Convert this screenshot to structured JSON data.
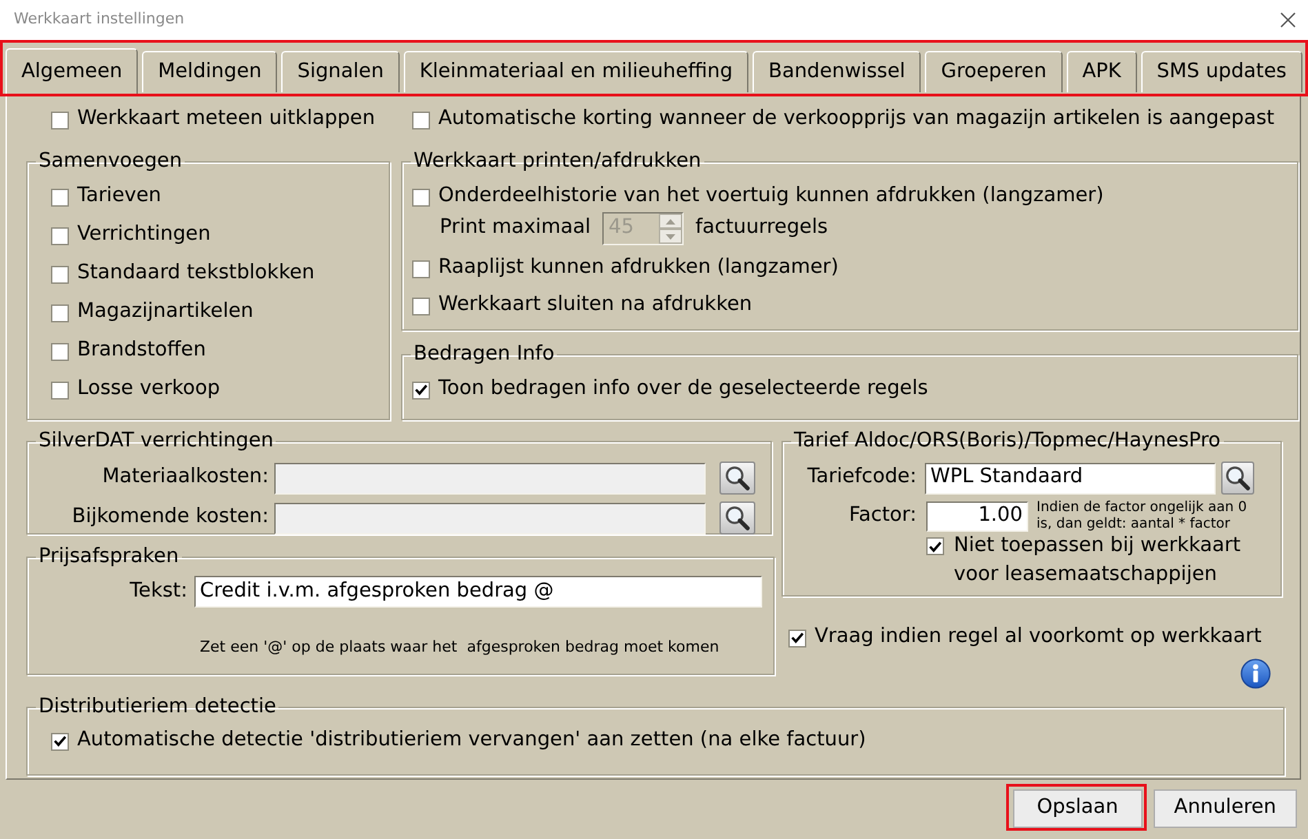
{
  "window": {
    "title": "Werkkaart instellingen"
  },
  "tab_bar": {
    "highlighted": true,
    "tabs": [
      {
        "label": "Algemeen",
        "selected": true
      },
      {
        "label": "Meldingen",
        "selected": false
      },
      {
        "label": "Signalen",
        "selected": false
      },
      {
        "label": "Kleinmateriaal en milieuheffing",
        "selected": false
      },
      {
        "label": "Bandenwissel",
        "selected": false
      },
      {
        "label": "Groeperen",
        "selected": false
      },
      {
        "label": "APK",
        "selected": false
      },
      {
        "label": "SMS updates",
        "selected": false
      }
    ]
  },
  "general_options": [
    {
      "label": "Werkkaart meteen uitklappen",
      "checked": false
    },
    {
      "label": "Automatische korting wanneer de verkoopprijs van magazijn artikelen is aangepast",
      "checked": false
    }
  ],
  "samenvoegen": {
    "title": "Samenvoegen",
    "options": [
      {
        "label": "Tarieven",
        "checked": false
      },
      {
        "label": "Verrichtingen",
        "checked": false
      },
      {
        "label": "Standaard tekstblokken",
        "checked": false
      },
      {
        "label": "Magazijnartikelen",
        "checked": false
      },
      {
        "label": "Brandstoffen",
        "checked": false
      },
      {
        "label": "Losse verkoop",
        "checked": false
      }
    ]
  },
  "werkkaart_printen": {
    "title": "Werkkaart printen/afdrukken",
    "items": [
      {
        "kind": "checkbox",
        "label": "Onderdeelhistorie van het voertuig kunnen afdrukken (langzamer)",
        "checked": false
      },
      {
        "kind": "spin",
        "label": "Print maximaal",
        "value": "45",
        "disabled": true,
        "unit": "factuurregels"
      },
      {
        "kind": "checkbox",
        "label": "Raaplijst kunnen afdrukken (langzamer)",
        "checked": false
      },
      {
        "kind": "checkbox",
        "label": "Werkkaart sluiten na afdrukken",
        "checked": false
      }
    ]
  },
  "bedragen_info": {
    "title": "Bedragen Info",
    "options": [
      {
        "label": "Toon bedragen info over de geselecteerde regels",
        "checked": true
      }
    ]
  },
  "silverdat": {
    "title": "SilverDAT verrichtingen",
    "fields": [
      {
        "label": "Materiaalkosten:",
        "disabled": true
      },
      {
        "label": "Bijkomende kosten:",
        "disabled": true
      }
    ]
  },
  "prijsafspraken": {
    "title": "Prijsafspraken",
    "field": {
      "label": "Tekst:",
      "value": "Credit i.v.m. afgesproken bedrag @"
    },
    "hint": "Zet een '@' op de plaats waar het  afgesproken bedrag moet komen"
  },
  "tarief": {
    "title": "Tarief Aldoc/ORS(Boris)/Topmec/HaynesPro",
    "code_field": {
      "label": "Tariefcode:",
      "value": "WPL Standaard"
    },
    "factor_field": {
      "label": "Factor:",
      "value": "1.00"
    },
    "factor_note": "Indien de factor ongelijk aan 0 is, dan geldt: aantal * factor",
    "option": {
      "label": "Niet toepassen bij werkkaart voor leasemaatschappijen",
      "checked": true
    }
  },
  "duplicate_check": {
    "label": "Vraag indien regel al voorkomt op werkkaart",
    "checked": true
  },
  "distributieriem": {
    "title": "Distributieriem detectie",
    "options": [
      {
        "label": "Automatische detectie 'distributieriem vervangen' aan zetten (na elke factuur)",
        "checked": true
      }
    ]
  },
  "buttons": [
    {
      "label": "Opslaan",
      "highlighted": true
    },
    {
      "label": "Annuleren",
      "highlighted": false
    }
  ]
}
